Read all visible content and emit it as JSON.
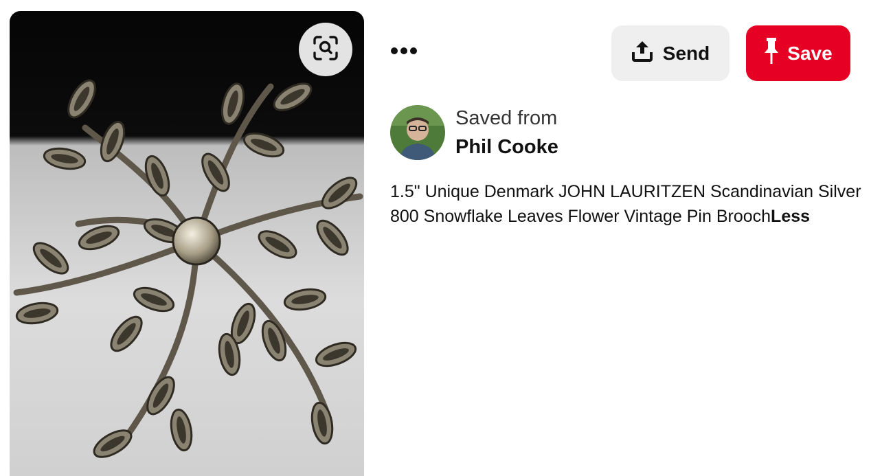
{
  "pin": {
    "image_alt": "Silver snowflake leaves flower brooch",
    "visual_search_icon": "visual-search-icon"
  },
  "toolbar": {
    "more_icon": "ellipsis-icon",
    "send_label": "Send",
    "send_icon": "share-upload-icon",
    "save_label": "Save",
    "save_icon": "pushpin-icon"
  },
  "attribution": {
    "saved_from_label": "Saved from",
    "source_name": "Phil Cooke"
  },
  "description": {
    "text": "1.5\" Unique Denmark JOHN LAURITZEN Scandinavian Silver 800 Snowflake Leaves Flower Vintage Pin Brooch",
    "less_label": "Less"
  },
  "colors": {
    "save_red": "#e60023",
    "send_gray": "#efefef"
  }
}
